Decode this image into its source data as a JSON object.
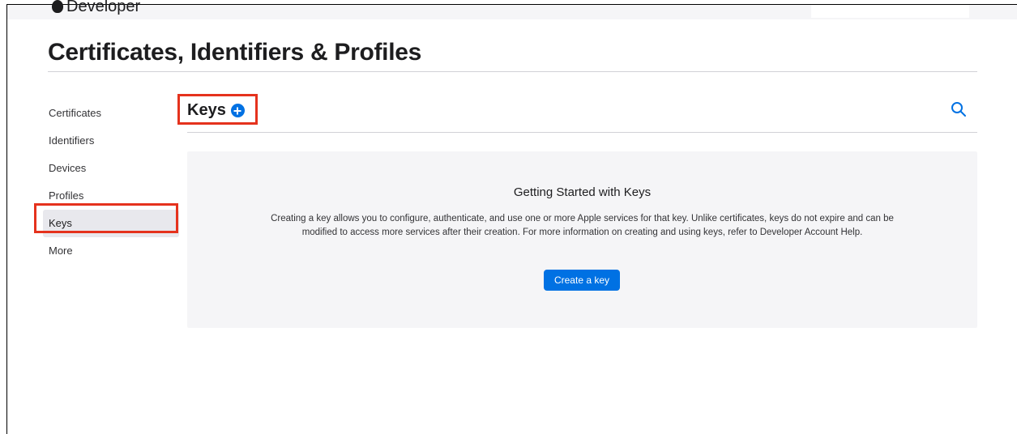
{
  "header": {
    "brand": "Developer"
  },
  "page": {
    "title": "Certificates, Identifiers & Profiles"
  },
  "sidebar": {
    "items": [
      {
        "label": "Certificates"
      },
      {
        "label": "Identifiers"
      },
      {
        "label": "Devices"
      },
      {
        "label": "Profiles"
      },
      {
        "label": "Keys",
        "active": true
      },
      {
        "label": "More"
      }
    ]
  },
  "section": {
    "title": "Keys",
    "add_icon": "plus-circle-icon",
    "search_icon": "search-icon"
  },
  "panel": {
    "title": "Getting Started with Keys",
    "body": "Creating a key allows you to configure, authenticate, and use one or more Apple services for that key. Unlike certificates, keys do not expire and can be modified to access more services after their creation. For more information on creating and using keys, refer to Developer Account Help.",
    "button_label": "Create a key"
  },
  "colors": {
    "accent": "#0071e3",
    "highlight": "#e5321d",
    "panel_bg": "#f5f5f7"
  }
}
